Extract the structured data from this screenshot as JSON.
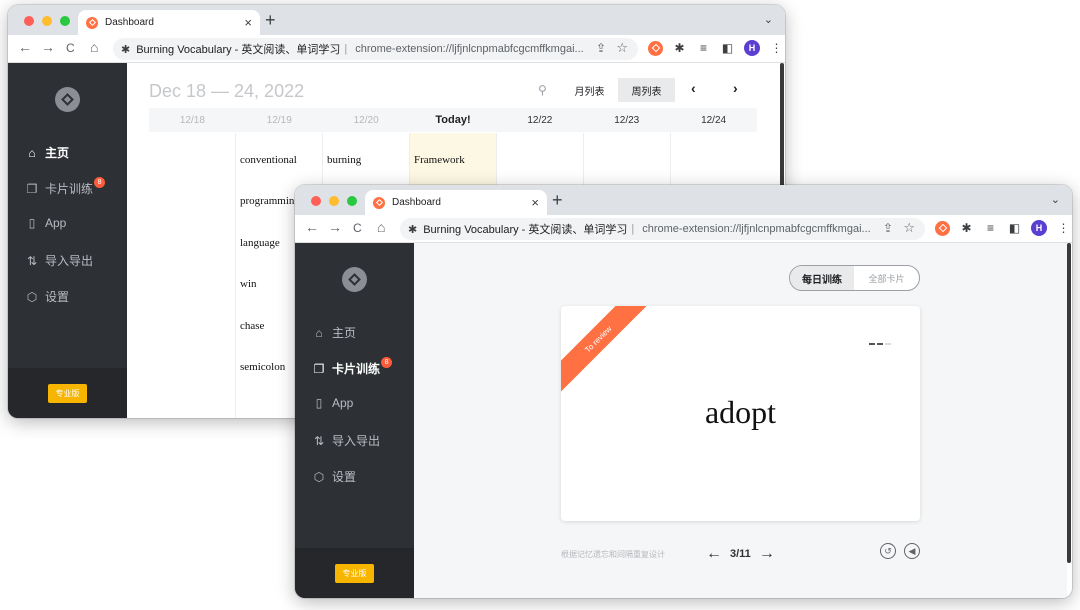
{
  "browser": {
    "tab_title": "Dashboard",
    "close_glyph": "×",
    "new_tab_glyph": "+",
    "menu_glyph": "⌄",
    "page_title": "Burning Vocabulary - 英文阅读、单词学习",
    "separator": "|",
    "url": "chrome-extension://ljfjnlcnpmabfcgcmffkmgai...",
    "profile_initial": "H",
    "nav": {
      "back": "←",
      "forward": "→",
      "reload": "C",
      "home": "⌂"
    }
  },
  "sidebar": {
    "items": [
      {
        "label": "主页",
        "icon": "home-icon"
      },
      {
        "label": "卡片训练",
        "icon": "cards-icon",
        "badge": "8"
      },
      {
        "label": "App",
        "icon": "phone-icon"
      },
      {
        "label": "导入导出",
        "icon": "import-export-icon"
      },
      {
        "label": "设置",
        "icon": "settings-icon"
      }
    ],
    "pro_label": "专业版"
  },
  "calendar": {
    "date_range": "Dec 18 — 24, 2022",
    "month_view_label": "月列表",
    "week_view_label": "周列表",
    "prev": "‹",
    "next": "›",
    "days": [
      "12/18",
      "12/19",
      "12/20",
      "Today!",
      "12/22",
      "12/23",
      "12/24"
    ],
    "words_1219": [
      "conventional",
      "programming",
      "language",
      "win",
      "chase",
      "semicolon"
    ],
    "words_1220": [
      "burning"
    ],
    "words_today": [
      "Framework"
    ]
  },
  "training": {
    "mode_daily": "每日训练",
    "mode_all": "全部卡片",
    "ribbon": "To review",
    "word": "adopt",
    "hint": "根据记忆遗忘和间隔重复设计",
    "counter": "3/11",
    "prev": "←",
    "next": "→"
  },
  "colors": {
    "accent": "#ff7043",
    "sidebar_bg": "#2d3035",
    "pro_button": "#f7b500",
    "badge": "#ff5b3a",
    "today_highlight": "#fdf8e3"
  }
}
